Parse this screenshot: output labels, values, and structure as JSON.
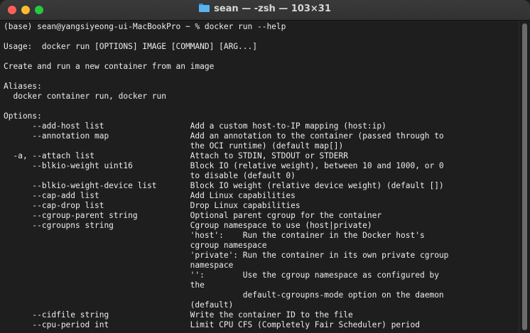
{
  "window": {
    "title": "sean — -zsh — 103×31"
  },
  "terminal": {
    "lines": [
      "(base) sean@yangsiyeong-ui-MacBookPro ~ % docker run --help",
      "",
      "Usage:  docker run [OPTIONS] IMAGE [COMMAND] [ARG...]",
      "",
      "Create and run a new container from an image",
      "",
      "Aliases:",
      "  docker container run, docker run",
      "",
      "Options:",
      "      --add-host list                  Add a custom host-to-IP mapping (host:ip)",
      "      --annotation map                 Add an annotation to the container (passed through to",
      "                                       the OCI runtime) (default map[])",
      "  -a, --attach list                    Attach to STDIN, STDOUT or STDERR",
      "      --blkio-weight uint16            Block IO (relative weight), between 10 and 1000, or 0",
      "                                       to disable (default 0)",
      "      --blkio-weight-device list       Block IO weight (relative device weight) (default [])",
      "      --cap-add list                   Add Linux capabilities",
      "      --cap-drop list                  Drop Linux capabilities",
      "      --cgroup-parent string           Optional parent cgroup for the container",
      "      --cgroupns string                Cgroup namespace to use (host|private)",
      "                                       'host':    Run the container in the Docker host's",
      "                                       cgroup namespace",
      "                                       'private': Run the container in its own private cgroup",
      "                                       namespace",
      "                                       '':        Use the cgroup namespace as configured by",
      "                                       the",
      "                                                  default-cgroupns-mode option on the daemon",
      "                                       (default)",
      "      --cidfile string                 Write the container ID to the file",
      "      --cpu-period int                 Limit CPU CFS (Completely Fair Scheduler) period"
    ]
  }
}
